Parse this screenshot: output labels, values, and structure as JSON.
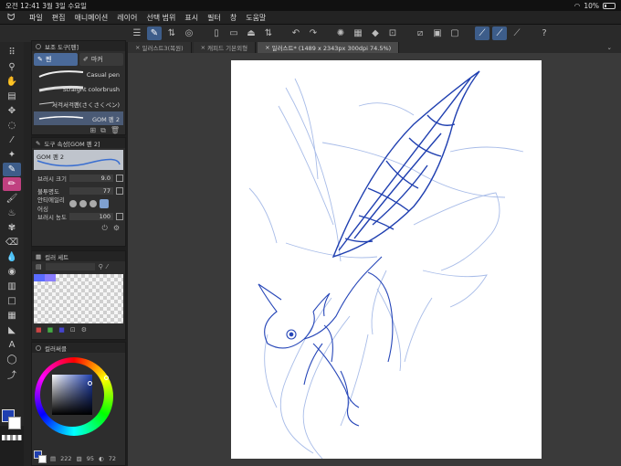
{
  "status_bar": {
    "time": "오전 12:41",
    "date": "3월 3일 수요일",
    "battery": "10%"
  },
  "menu": {
    "items": [
      "파일",
      "편집",
      "애니메이션",
      "레이어",
      "선택 범위",
      "표시",
      "필터",
      "창",
      "도움말"
    ]
  },
  "subtool": {
    "title": "보조 도구[펜]",
    "tabs": [
      "펜",
      "마커"
    ],
    "brushes": [
      "Casual pen",
      "Straight colorbrush",
      "서걱서걱펜(さくさくペン)",
      "GOM 펜 2"
    ],
    "selected_index": 3
  },
  "tool_property": {
    "title": "도구 속성[GOM 펜 2]",
    "preview_label": "GOM 펜 2",
    "brush_size_label": "브러시 크기",
    "brush_size_value": "9.0",
    "opacity_label": "불투명도",
    "opacity_value": "77",
    "antialias_label": "안티에일리어싱",
    "density_label": "브러시 농도",
    "density_value": "100"
  },
  "color_set": {
    "title": "컬러 세트",
    "swatches": [
      "#5a6bff",
      "#8a7dff"
    ]
  },
  "color_wheel": {
    "title": "컬러써클",
    "hsv": [
      "222",
      "95",
      "72"
    ],
    "selected_color": "#1f3fb0"
  },
  "doc_tabs": [
    "일러스트3(복원)",
    "캐피드 기본외형",
    "일러스트* (1489 x 2343px 300dpi 74.5%)"
  ],
  "colors": {
    "accent": "#3d5d8a",
    "ink": "#1f3fb0",
    "sketch": "#9fb4e8"
  }
}
